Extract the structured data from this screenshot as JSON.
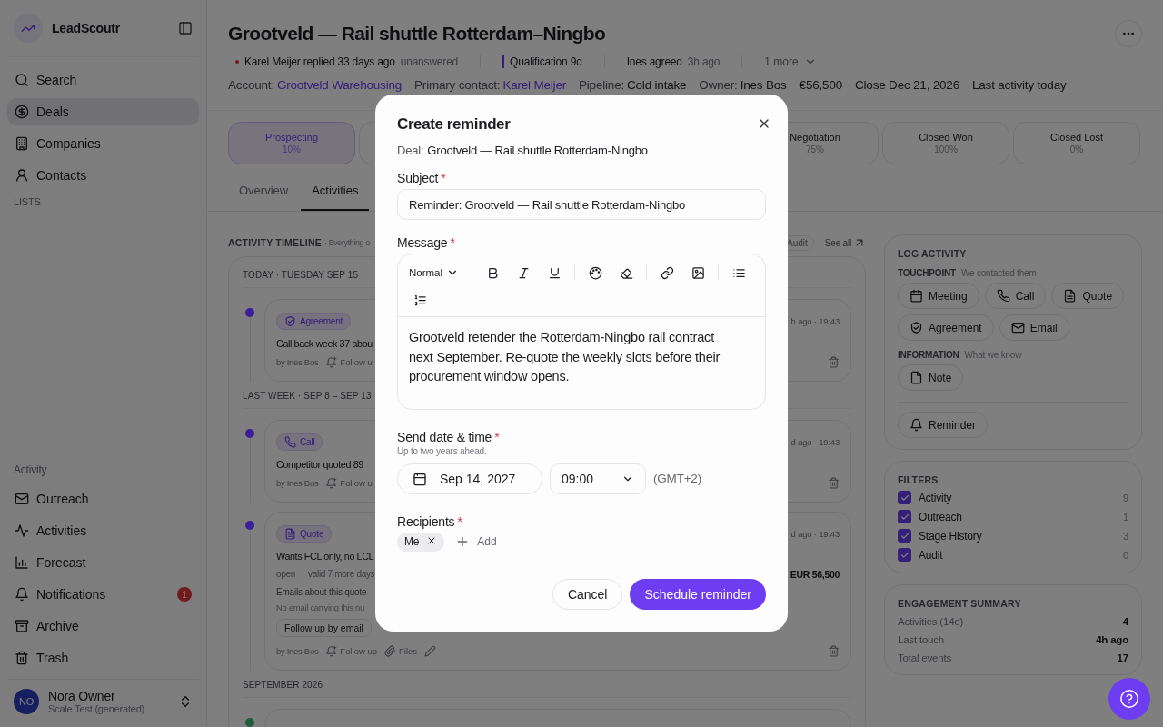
{
  "sidebar": {
    "brand": "LeadScoutr",
    "nav": [
      {
        "label": "Search",
        "selected": false
      },
      {
        "label": "Deals",
        "selected": true
      },
      {
        "label": "Companies",
        "selected": false
      },
      {
        "label": "Contacts",
        "selected": false
      }
    ],
    "lists_heading": "LISTS",
    "activity_heading": "Activity",
    "activity_nav": [
      {
        "label": "Outreach",
        "selected": false
      },
      {
        "label": "Activities",
        "selected": false
      },
      {
        "label": "Forecast",
        "selected": false
      },
      {
        "label": "Notifications",
        "selected": false,
        "badge": "1"
      },
      {
        "label": "Archive",
        "selected": false
      },
      {
        "label": "Trash",
        "selected": false
      }
    ],
    "user": {
      "initials": "NO",
      "name": "Nora Owner",
      "workspace": "Scale Test (generated)"
    }
  },
  "deal": {
    "title": "Grootveld — Rail shuttle Rotterdam–Ningbo",
    "signals": [
      {
        "kind": "reply",
        "text": "Karel Meijer replied 33 days ago",
        "note": "unanswered"
      },
      {
        "kind": "stage",
        "text": "Qualification 9d"
      },
      {
        "kind": "agreement",
        "text": "Ines agreed",
        "note": "3h ago"
      },
      {
        "kind": "more",
        "text": "1 more"
      }
    ],
    "meta": [
      {
        "label": "Account:",
        "value": "Grootveld Warehousing",
        "link": true
      },
      {
        "label": "Primary contact:",
        "value": "Karel Meijer",
        "link": true
      },
      {
        "label": "Pipeline:",
        "value": "Cold intake",
        "link": false
      },
      {
        "label": "Owner:",
        "value": "Ines Bos",
        "link": false
      },
      {
        "value": "€56,500",
        "link": false
      },
      {
        "value": "Close Dec 21, 2026",
        "link": false
      },
      {
        "value": "Last activity today",
        "link": false
      }
    ]
  },
  "stages": [
    {
      "name": "Prospecting",
      "percent": "10%",
      "selected": true
    },
    {
      "name": "Negotiation",
      "percent": "75%",
      "selected": false
    },
    {
      "name": "Closed Won",
      "percent": "100%",
      "selected": false
    },
    {
      "name": "Closed Lost",
      "percent": "0%",
      "selected": false
    }
  ],
  "tabs": [
    {
      "label": "Overview",
      "selected": false
    },
    {
      "label": "Activities",
      "selected": true
    }
  ],
  "timeline": {
    "heading": "ACTIVITY TIMELINE",
    "subheading": "· Everything o",
    "filter_chip": "Audit",
    "see_all": "See all",
    "groups": [
      {
        "heading": "TODAY · TUESDAY SEP 15",
        "items": [
          {
            "kind": "agreement",
            "color": "#3b1f99",
            "tag": "Agreement",
            "title": "Call back week 37 abou",
            "author": "by Ines Bos",
            "follow_up": "Follow u",
            "time": "h ago · 19:43"
          }
        ]
      },
      {
        "heading": "LAST WEEK · SEP 8 – SEP 13",
        "items": [
          {
            "kind": "call",
            "color": "#3b1f99",
            "tag": "Call",
            "title": "Competitor quoted 89",
            "author": "by Ines Bos",
            "follow_up": "Follow u",
            "time": "d ago · 19:43"
          },
          {
            "kind": "quote",
            "color": "#3b1f99",
            "tag": "Quote",
            "title": "Wants FCL only, no LCL",
            "status": "open",
            "validity": "valid 7 more days",
            "amount": "EUR 56,500",
            "emails_heading": "Emails about this quote",
            "emails_note": "No email carrying this nu",
            "action": "Follow up by email",
            "author": "by Ines Bos",
            "follow_up": "Follow up",
            "files": "Files",
            "time": "d ago · 19:43"
          }
        ]
      },
      {
        "heading": "SEPTEMBER 2026",
        "items": [
          {
            "kind": "stage",
            "color": "#1d5f3a"
          }
        ]
      }
    ]
  },
  "log_activity": {
    "heading": "LOG ACTIVITY",
    "touchpoint_heading": "TOUCHPOINT",
    "touchpoint_hint": "We contacted them",
    "touchpoints": [
      "Meeting",
      "Call",
      "Quote",
      "Agreement",
      "Email"
    ],
    "information_heading": "INFORMATION",
    "information_hint": "What we know",
    "information": [
      "Note"
    ],
    "reminder": "Reminder"
  },
  "filters": {
    "heading": "FILTERS",
    "items": [
      {
        "label": "Activity",
        "count": "9",
        "checked": true
      },
      {
        "label": "Outreach",
        "count": "1",
        "checked": true
      },
      {
        "label": "Stage History",
        "count": "3",
        "checked": true
      },
      {
        "label": "Audit",
        "count": "0",
        "checked": true
      }
    ]
  },
  "engagement": {
    "heading": "ENGAGEMENT SUMMARY",
    "rows": [
      {
        "label": "Activities (14d)",
        "value": "4"
      },
      {
        "label": "Last touch",
        "value": "4h ago"
      },
      {
        "label": "Total events",
        "value": "17"
      }
    ]
  },
  "modal": {
    "title": "Create reminder",
    "deal_label": "Deal:",
    "deal": "Grootveld — Rail shuttle Rotterdam-Ningbo",
    "subject": {
      "label": "Subject",
      "required_mark": "*",
      "value": "Reminder: Grootveld — Rail shuttle Rotterdam-Ningbo"
    },
    "message": {
      "label": "Message",
      "required_mark": "*",
      "format": "Normal",
      "body": "Grootveld retender the Rotterdam-Ningbo rail contract next September. Re-quote the weekly slots before their procurement window opens."
    },
    "send": {
      "label": "Send date & time",
      "required_mark": "*",
      "hint": "Up to two years ahead.",
      "date": "Sep 14, 2027",
      "time": "09:00",
      "timezone": "(GMT+2)"
    },
    "recipients": {
      "label": "Recipients",
      "required_mark": "*",
      "chips": [
        "Me"
      ],
      "add": "Add"
    },
    "cancel": "Cancel",
    "submit": "Schedule reminder"
  }
}
